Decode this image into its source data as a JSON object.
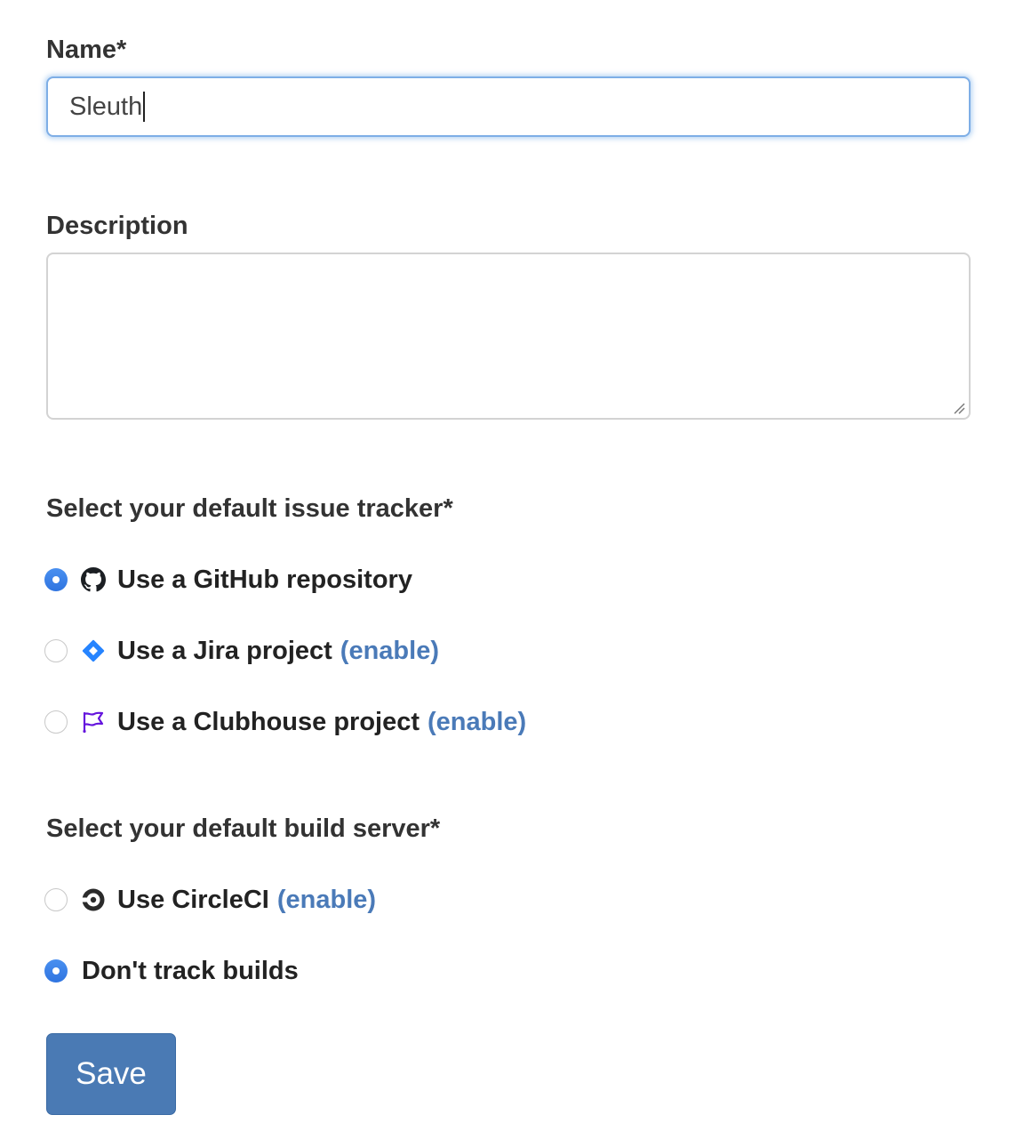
{
  "name_field": {
    "label": "Name*",
    "value": "Sleuth"
  },
  "description_field": {
    "label": "Description",
    "value": ""
  },
  "issue_tracker": {
    "heading": "Select your default issue tracker*",
    "options": [
      {
        "label": "Use a GitHub repository",
        "icon": "github-icon",
        "selected": true,
        "link": ""
      },
      {
        "label": "Use a Jira project",
        "icon": "jira-icon",
        "selected": false,
        "link": "(enable)"
      },
      {
        "label": "Use a Clubhouse project",
        "icon": "clubhouse-icon",
        "selected": false,
        "link": "(enable)"
      }
    ]
  },
  "build_server": {
    "heading": "Select your default build server*",
    "options": [
      {
        "label": "Use CircleCI",
        "icon": "circleci-icon",
        "selected": false,
        "link": "(enable)"
      },
      {
        "label": "Don't track builds",
        "icon": "",
        "selected": true,
        "link": ""
      }
    ]
  },
  "save_button": {
    "label": "Save"
  },
  "colors": {
    "radio_checked": "#3b82f6",
    "link": "#4a7ab8",
    "button": "#4a7ab4",
    "focus_border": "#7eaee6",
    "jira_blue": "#2684ff",
    "clubhouse_purple": "#6515dd"
  }
}
